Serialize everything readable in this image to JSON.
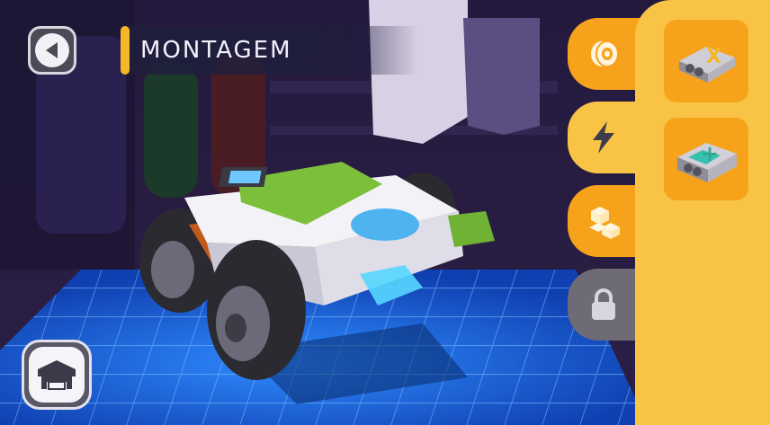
{
  "header": {
    "title": "MONTAGEM"
  },
  "buttons": {
    "back_icon": "back-arrow-icon",
    "garage_icon": "garage-icon"
  },
  "tabs": [
    {
      "icon": "wheel-icon",
      "state": "orange"
    },
    {
      "icon": "lightning-icon",
      "state": "active"
    },
    {
      "icon": "blocks-icon",
      "state": "orange"
    },
    {
      "icon": "lock-icon",
      "state": "locked"
    }
  ],
  "parts": [
    {
      "icon": "battery-pack-remove-icon",
      "badge": "X"
    },
    {
      "icon": "battery-pack-add-icon",
      "badge": "+"
    }
  ],
  "colors": {
    "accent": "#f5b727",
    "panel": "#f9c445",
    "card": "#f7a21b",
    "locked": "#6e6b76",
    "floor_grid": "#1e6fe0"
  }
}
